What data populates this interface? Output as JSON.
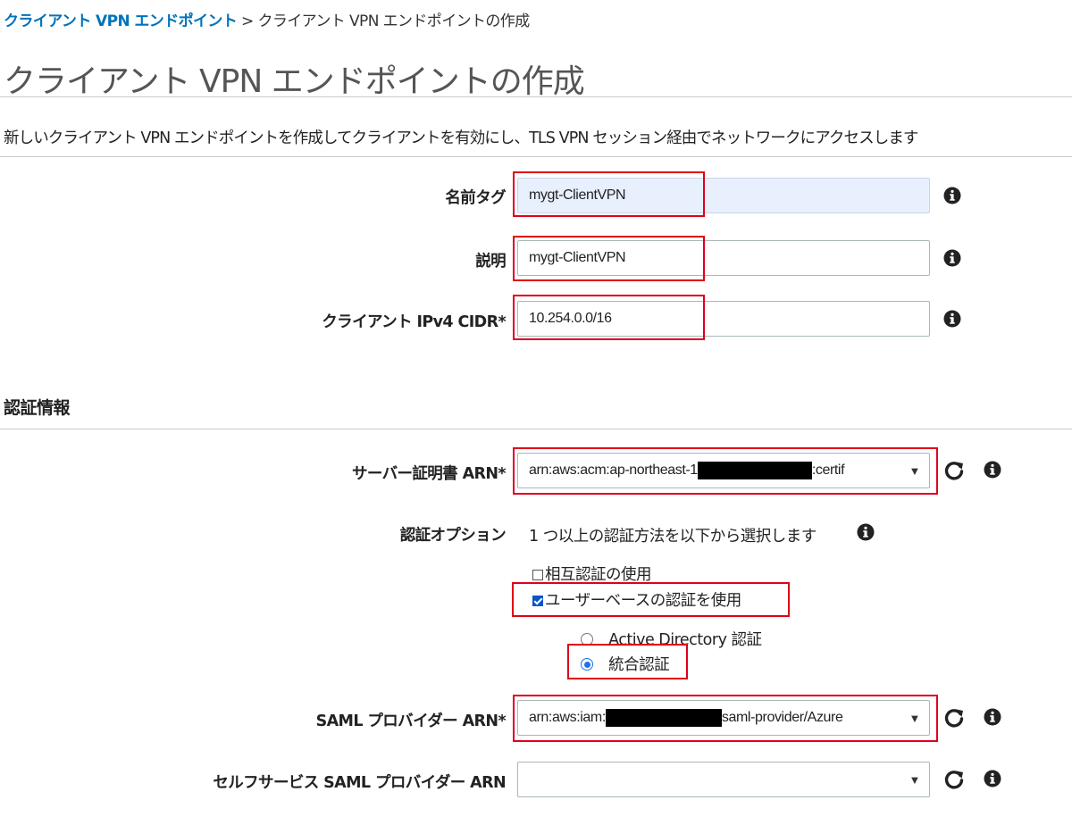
{
  "breadcrumb": {
    "link": "クライアント VPN エンドポイント",
    "separator": ">",
    "current": "クライアント VPN エンドポイントの作成"
  },
  "page": {
    "title": "クライアント VPN エンドポイントの作成",
    "description": "新しいクライアント VPN エンドポイントを作成してクライアントを有効にし、TLS VPN セッション経由でネットワークにアクセスします"
  },
  "form": {
    "name_tag": {
      "label": "名前タグ",
      "value": "mygt-ClientVPN"
    },
    "description": {
      "label": "説明",
      "value": "mygt-ClientVPN"
    },
    "client_cidr": {
      "label": "クライアント IPv4 CIDR*",
      "value": "10.254.0.0/16"
    }
  },
  "auth": {
    "section_title": "認証情報",
    "server_cert": {
      "label": "サーバー証明書 ARN*",
      "value_prefix": "arn:aws:acm:ap-northeast-1",
      "value_suffix": ":certif"
    },
    "auth_option": {
      "label": "認証オプション",
      "hint": "1 つ以上の認証方法を以下から選択します",
      "mutual": "相互認証の使用",
      "user_based": "ユーザーベースの認証を使用",
      "active_directory": "Active Directory 認証",
      "federated": "統合認証",
      "mutual_checked": false,
      "user_based_checked": true,
      "selected_method": "federated"
    },
    "saml_provider": {
      "label": "SAML プロバイダー ARN*",
      "value_prefix": "arn:aws:iam:",
      "value_suffix": "saml-provider/Azure"
    },
    "self_service_saml": {
      "label": "セルフサービス SAML プロバイダー ARN",
      "value": ""
    }
  },
  "colors": {
    "link": "#0073bb",
    "highlight": "#e0001b",
    "autofill": "#e8f0fe",
    "radio": "#1a73e8"
  },
  "icons": [
    "info-icon",
    "refresh-icon",
    "chevron-down-icon"
  ]
}
